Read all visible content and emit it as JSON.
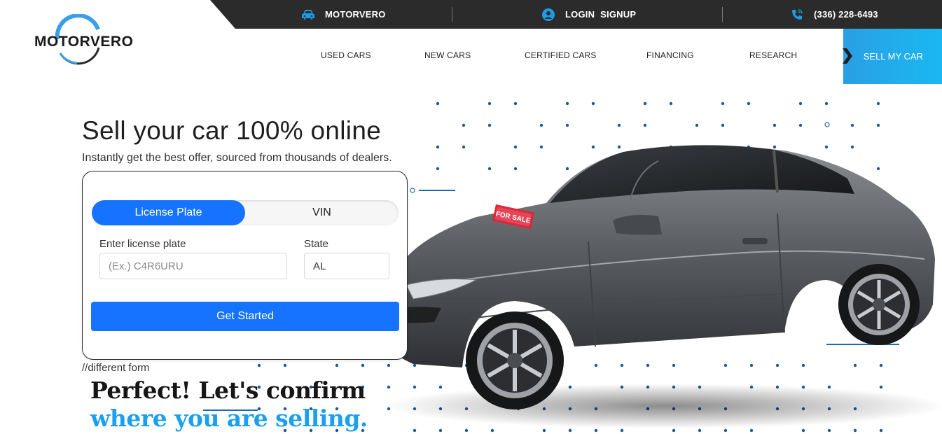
{
  "topbar": {
    "brand": "MOTORVERO",
    "login": "LOGIN",
    "signup": "SIGNUP",
    "phone": "(336) 228-6493",
    "icons": [
      "car-icon",
      "user-icon",
      "phone-icon"
    ],
    "accent": "#1a9de6"
  },
  "logo": {
    "text": "MOTORVERO"
  },
  "nav": {
    "items": [
      "USED CARS",
      "NEW CARS",
      "CERTIFIED CARS",
      "FINANCING",
      "RESEARCH"
    ],
    "cta": "SELL MY CAR"
  },
  "hero": {
    "title": "Sell your car 100% online",
    "subtitle": "Instantly get the best offer, sourced from thousands of dealers."
  },
  "form": {
    "tabs": [
      "License Plate",
      "VIN"
    ],
    "active_tab": "License Plate",
    "plate_label": "Enter license plate",
    "plate_placeholder": "(Ex.) C4R6URU",
    "state_label": "State",
    "state_value": "AL",
    "submit": "Get Started",
    "primary_color": "#1673ff"
  },
  "comment": "//different form",
  "confirm": {
    "line1": "Perfect! Let's confirm",
    "line2": "where you are selling."
  },
  "car": {
    "sticker": "FOR SALE"
  }
}
